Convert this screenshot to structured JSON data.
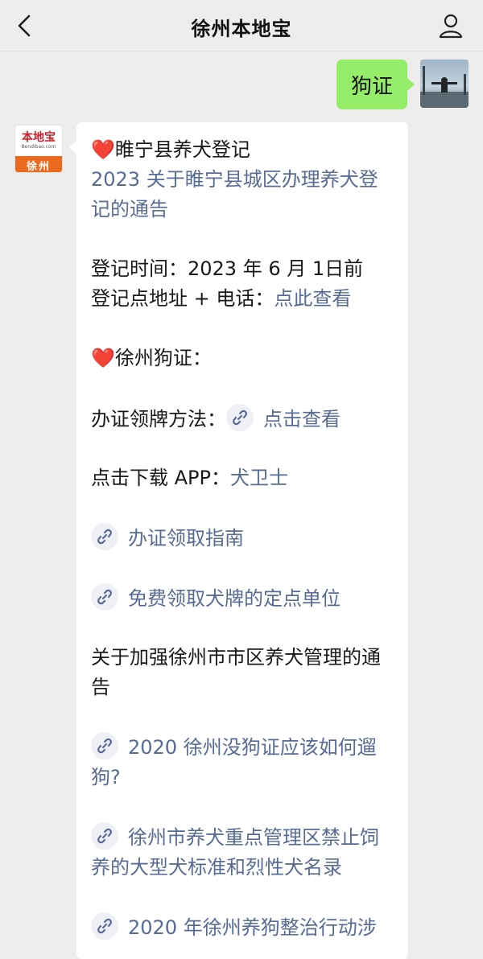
{
  "header": {
    "title": "徐州本地宝",
    "back_icon": "chevron-left-icon",
    "profile_icon": "person-icon"
  },
  "outgoing": {
    "text": "狗证"
  },
  "account_avatar": {
    "logo": "本地宝",
    "site": "Bendibao.com",
    "city": "徐州"
  },
  "message": {
    "suining_title": "睢宁县养犬登记",
    "suining_notice_link": "2023 关于睢宁县城区办理养犬登记的通告",
    "reg_time": "登记时间：2023 年 6 月 1日前",
    "reg_address_label": "登记点地址 + 电话：",
    "reg_address_link": "点此查看",
    "xuzhou_title": "徐州狗证：",
    "method_label": "办证领牌方法：",
    "method_link": "点击查看",
    "app_label": "点击下载 APP：",
    "app_link": "犬卫士",
    "guide_link": "办证领取指南",
    "free_tag_link": "免费领取犬牌的定点单位",
    "notice_text": "关于加强徐州市市区养犬管理的通告",
    "walk_link": "2020 徐州没狗证应该如何遛狗?",
    "banned_link": "徐州市养犬重点管理区禁止饲养的大型犬标准和烈性犬名录",
    "campaign_link": "2020 年徐州养狗整治行动涉"
  },
  "colors": {
    "background": "#ededed",
    "outgoing_bubble": "#95ec69",
    "link": "#576b95",
    "heart": "#e02b2b",
    "brand_orange": "#ec6a1f"
  }
}
